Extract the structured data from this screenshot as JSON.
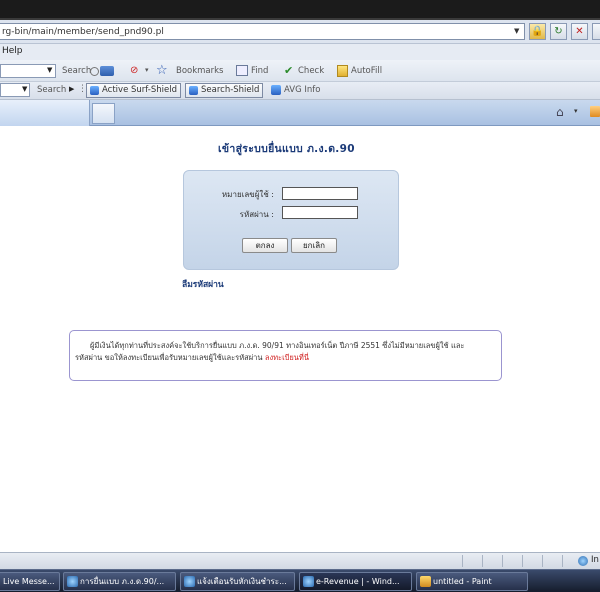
{
  "browser": {
    "address_url": "rg-bin/main/member/send_pnd90.pl",
    "menu_help": "Help",
    "toolbar": {
      "search_label": "Search",
      "bookmarks_label": "Bookmarks",
      "find_label": "Find",
      "check_label": "Check",
      "autofill_label": "AutoFill",
      "search2_label": "Search",
      "active_surf_shield": "Active Surf-Shield",
      "search_shield": "Search-Shield",
      "avg_info": "AVG Info"
    }
  },
  "page": {
    "title": "เข้าสู่ระบบยื่นแบบ ภ.ง.ด.90",
    "login": {
      "username_label": "หมายเลขผู้ใช้ :",
      "password_label": "รหัสผ่าน :",
      "ok_button": "ตกลง",
      "cancel_button": "ยกเลิก"
    },
    "forgot_password": "ลืมรหัสผ่าน",
    "notice": {
      "line1": "ผู้มีเงินได้ทุกท่านที่ประสงค์จะใช้บริการยื่นแบบ ภ.ง.ด. 90/91 ทางอินเทอร์เน็ต ปีภาษี 2551 ซึ่งไม่มีหมายเลขผู้ใช้ และ",
      "line2_prefix": "รหัสผ่าน ขอให้ลงทะเบียนเพื่อรับหมายเลขผู้ใช้และรหัสผ่าน ",
      "line2_link": "ลงทะเบียนที่นี่"
    }
  },
  "statusbar": {
    "zone": "In"
  },
  "taskbar": {
    "items": [
      {
        "label": "Live Messe..."
      },
      {
        "label": "การยื่นแบบ ภ.ง.ด.90/..."
      },
      {
        "label": "แจ้งเตือนรับหักเงินชำระ..."
      },
      {
        "label": "e-Revenue | - Wind..."
      },
      {
        "label": "untitled - Paint"
      }
    ]
  },
  "colors": {
    "title_blue": "#1b3a78",
    "panel_bg": "#c4d4e8",
    "notice_border": "#9b95d0",
    "link_red": "#d02020"
  }
}
